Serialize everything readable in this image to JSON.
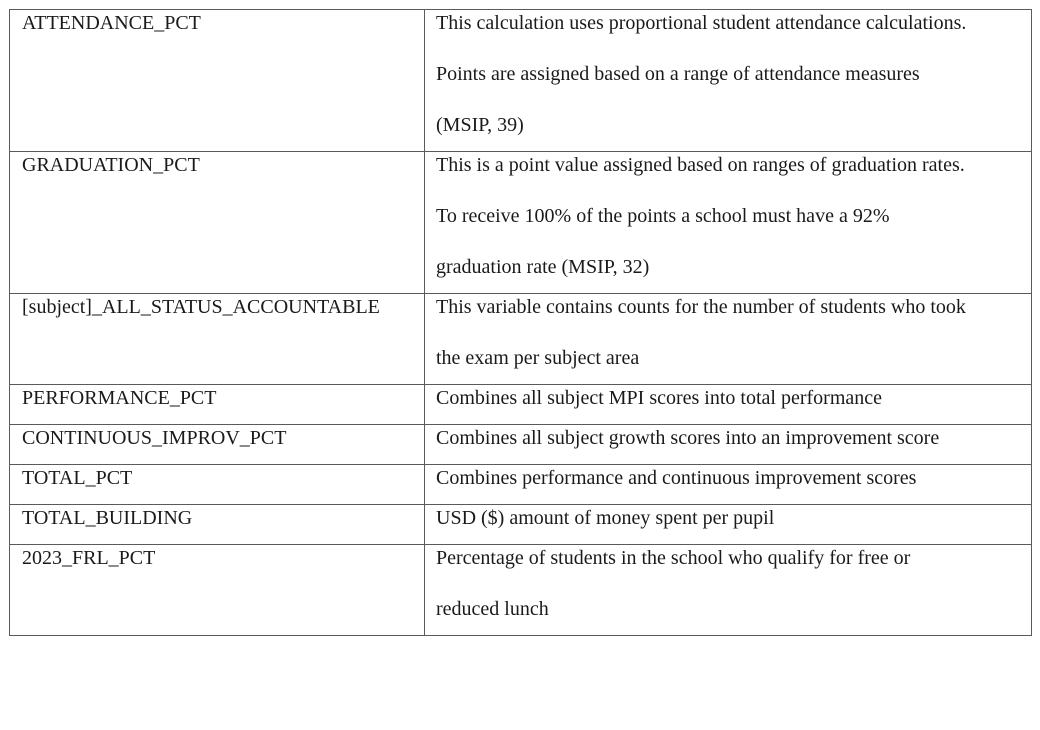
{
  "rows": [
    {
      "variable": "ATTENDANCE_PCT",
      "description_lines": [
        "This calculation uses proportional student attendance calculations.",
        "Points are assigned based on a range of attendance measures",
        "(MSIP, 39)"
      ]
    },
    {
      "variable": "GRADUATION_PCT",
      "description_lines": [
        "This is a point value assigned based on ranges of graduation rates.",
        "To receive 100% of the points a school must have a 92%",
        "graduation rate (MSIP, 32)"
      ]
    },
    {
      "variable": "[subject]_ALL_STATUS_ACCOUNTABLE",
      "description_lines": [
        "This variable contains counts for the number of students who took",
        "the exam per subject area"
      ]
    },
    {
      "variable": "PERFORMANCE_PCT",
      "description_lines": [
        "Combines all subject MPI scores into total performance"
      ]
    },
    {
      "variable": "CONTINUOUS_IMPROV_PCT",
      "description_lines": [
        "Combines all subject growth scores into an improvement score"
      ]
    },
    {
      "variable": "TOTAL_PCT",
      "description_lines": [
        "Combines performance and continuous improvement scores"
      ]
    },
    {
      "variable": "TOTAL_BUILDING",
      "description_lines": [
        "USD ($) amount of money spent per pupil"
      ]
    },
    {
      "variable": "2023_FRL_PCT",
      "description_lines": [
        "Percentage of students in the school who qualify for free or",
        "reduced lunch"
      ]
    }
  ]
}
